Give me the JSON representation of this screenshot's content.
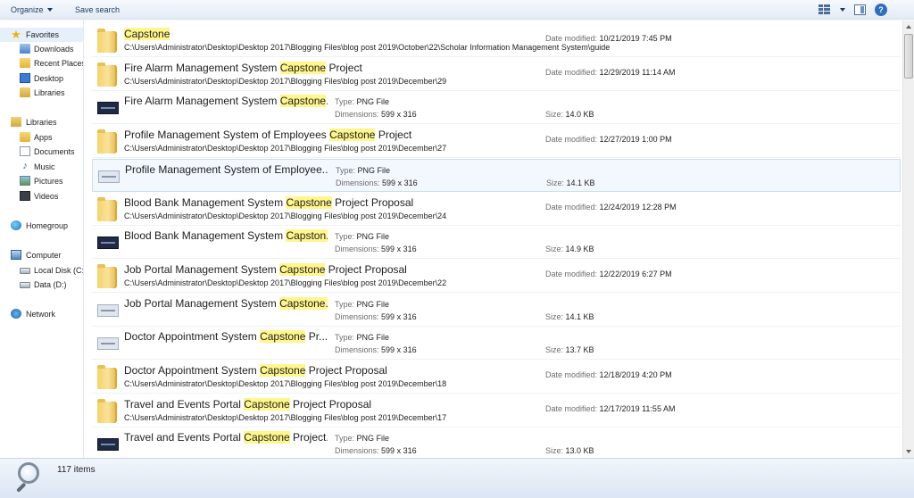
{
  "toolbar": {
    "organize": "Organize",
    "save_search": "Save search"
  },
  "sidebar": {
    "favorites": "Favorites",
    "downloads": "Downloads",
    "recent_places": "Recent Places",
    "desktop": "Desktop",
    "libraries_fav": "Libraries",
    "libraries": "Libraries",
    "apps": "Apps",
    "documents": "Documents",
    "music": "Music",
    "pictures": "Pictures",
    "videos": "Videos",
    "homegroup": "Homegroup",
    "computer": "Computer",
    "local_disk": "Local Disk (C:)",
    "data_d": "Data (D:)",
    "network": "Network"
  },
  "labels": {
    "date_modified": "Date modified:",
    "type": "Type:",
    "dimensions": "Dimensions:",
    "size": "Size:"
  },
  "results": [
    {
      "kind": "folder",
      "pre": "",
      "hl": "Capstone",
      "post": "",
      "path": "C:\\Users\\Administrator\\Desktop\\Desktop 2017\\Blogging Files\\blog post 2019\\October\\22\\Scholar Information Management System\\guide",
      "date": "10/21/2019 7:45 PM"
    },
    {
      "kind": "folder",
      "pre": "Fire Alarm Management System ",
      "hl": "Capstone",
      "post": " Project",
      "path": "C:\\Users\\Administrator\\Desktop\\Desktop 2017\\Blogging Files\\blog post 2019\\December\\29",
      "date": "12/29/2019 11:14 AM"
    },
    {
      "kind": "png-dark",
      "pre": "Fire Alarm Management System ",
      "hl": "Capstone",
      "post": "...",
      "type": "PNG File",
      "dims": "599 x 316",
      "size": "14.0 KB"
    },
    {
      "kind": "folder",
      "pre": "Profile Management System of Employees ",
      "hl": "Capstone",
      "post": " Project",
      "path": "C:\\Users\\Administrator\\Desktop\\Desktop 2017\\Blogging Files\\blog post 2019\\December\\27",
      "date": "12/27/2019 1:00 PM"
    },
    {
      "kind": "png-light",
      "pre": "Profile Management System of Employee...",
      "hl": "",
      "post": "",
      "type": "PNG File",
      "dims": "599 x 316",
      "size": "14.1 KB",
      "selected": true
    },
    {
      "kind": "folder",
      "pre": "Blood Bank Management System ",
      "hl": "Capstone",
      "post": " Project Proposal",
      "path": "C:\\Users\\Administrator\\Desktop\\Desktop 2017\\Blogging Files\\blog post 2019\\December\\24",
      "date": "12/24/2019 12:28 PM"
    },
    {
      "kind": "png-dark",
      "pre": "Blood Bank Management System ",
      "hl": "Capston...",
      "post": "",
      "type": "PNG File",
      "dims": "599 x 316",
      "size": "14.9 KB"
    },
    {
      "kind": "folder",
      "pre": "Job Portal Management System ",
      "hl": "Capstone",
      "post": " Project Proposal",
      "path": "C:\\Users\\Administrator\\Desktop\\Desktop 2017\\Blogging Files\\blog post 2019\\December\\22",
      "date": "12/22/2019 6:27 PM"
    },
    {
      "kind": "png-light",
      "pre": "Job Portal Management System ",
      "hl": "Capstone...",
      "post": "",
      "type": "PNG File",
      "dims": "599 x 316",
      "size": "14.1 KB"
    },
    {
      "kind": "png-light",
      "pre": "Doctor Appointment System ",
      "hl": "Capstone",
      "post": " Pr...",
      "type": "PNG File",
      "dims": "599 x 316",
      "size": "13.7 KB"
    },
    {
      "kind": "folder",
      "pre": "Doctor Appointment System ",
      "hl": "Capstone",
      "post": " Project Proposal",
      "path": "C:\\Users\\Administrator\\Desktop\\Desktop 2017\\Blogging Files\\blog post 2019\\December\\18",
      "date": "12/18/2019 4:20 PM"
    },
    {
      "kind": "folder",
      "pre": "Travel and Events Portal ",
      "hl": "Capstone",
      "post": " Project Proposal",
      "path": "C:\\Users\\Administrator\\Desktop\\Desktop 2017\\Blogging Files\\blog post 2019\\December\\17",
      "date": "12/17/2019 11:55 AM"
    },
    {
      "kind": "png-dark",
      "pre": "Travel and Events Portal ",
      "hl": "Capstone",
      "post": " Project...",
      "type": "PNG File",
      "dims": "599 x 316",
      "size": "13.0 KB"
    }
  ],
  "status": {
    "item_count": "117 items"
  }
}
